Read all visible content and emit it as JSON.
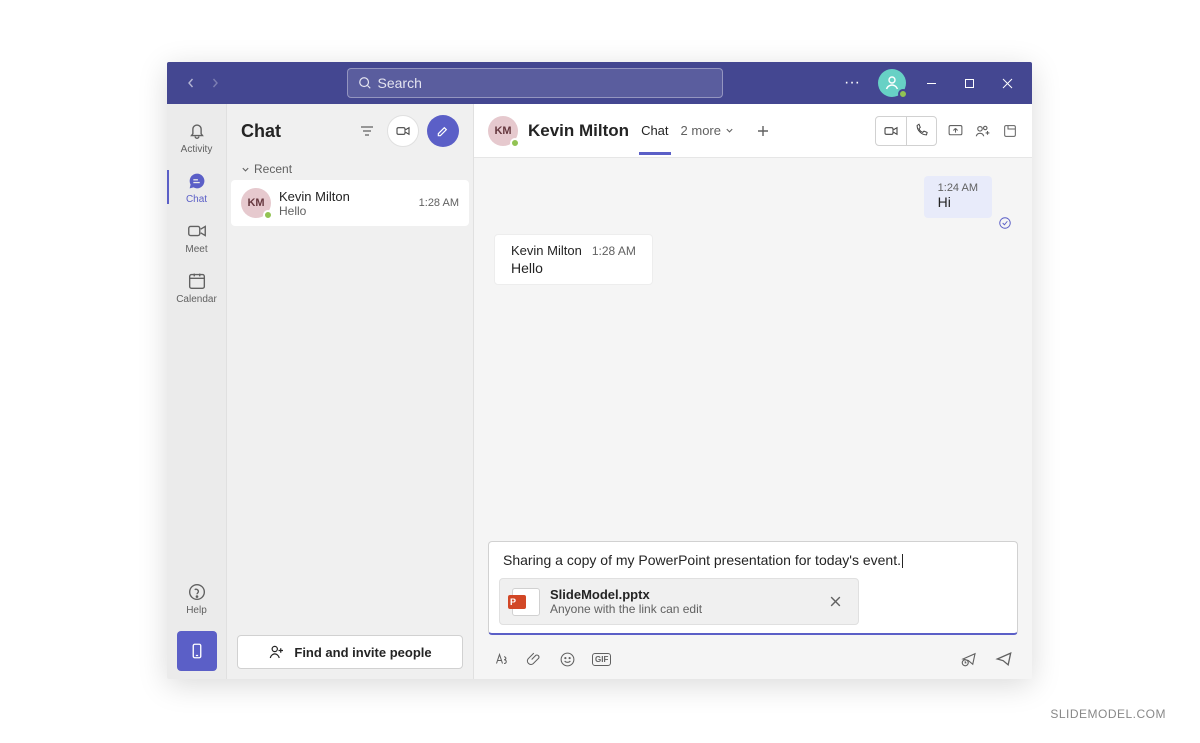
{
  "titlebar": {
    "search_placeholder": "Search"
  },
  "rail": {
    "activity": "Activity",
    "chat": "Chat",
    "meet": "Meet",
    "calendar": "Calendar",
    "help": "Help"
  },
  "chatlist": {
    "title": "Chat",
    "section_recent": "Recent",
    "items": [
      {
        "initials": "KM",
        "name": "Kevin Milton",
        "preview": "Hello",
        "time": "1:28 AM"
      }
    ],
    "find_people": "Find and invite people"
  },
  "conversation": {
    "avatar_initials": "KM",
    "title": "Kevin Milton",
    "tabs": {
      "chat": "Chat",
      "more": "2 more"
    },
    "messages": {
      "out": {
        "time": "1:24 AM",
        "text": "Hi"
      },
      "in": {
        "sender": "Kevin Milton",
        "time": "1:28 AM",
        "text": "Hello"
      }
    },
    "compose": {
      "text": "Sharing a copy of my PowerPoint presentation for today's event.",
      "attachment": {
        "icon_letter": "P",
        "filename": "SlideModel.pptx",
        "permission": "Anyone with the link can edit"
      },
      "gif_label": "GIF"
    }
  },
  "watermark": "SLIDEMODEL.COM"
}
